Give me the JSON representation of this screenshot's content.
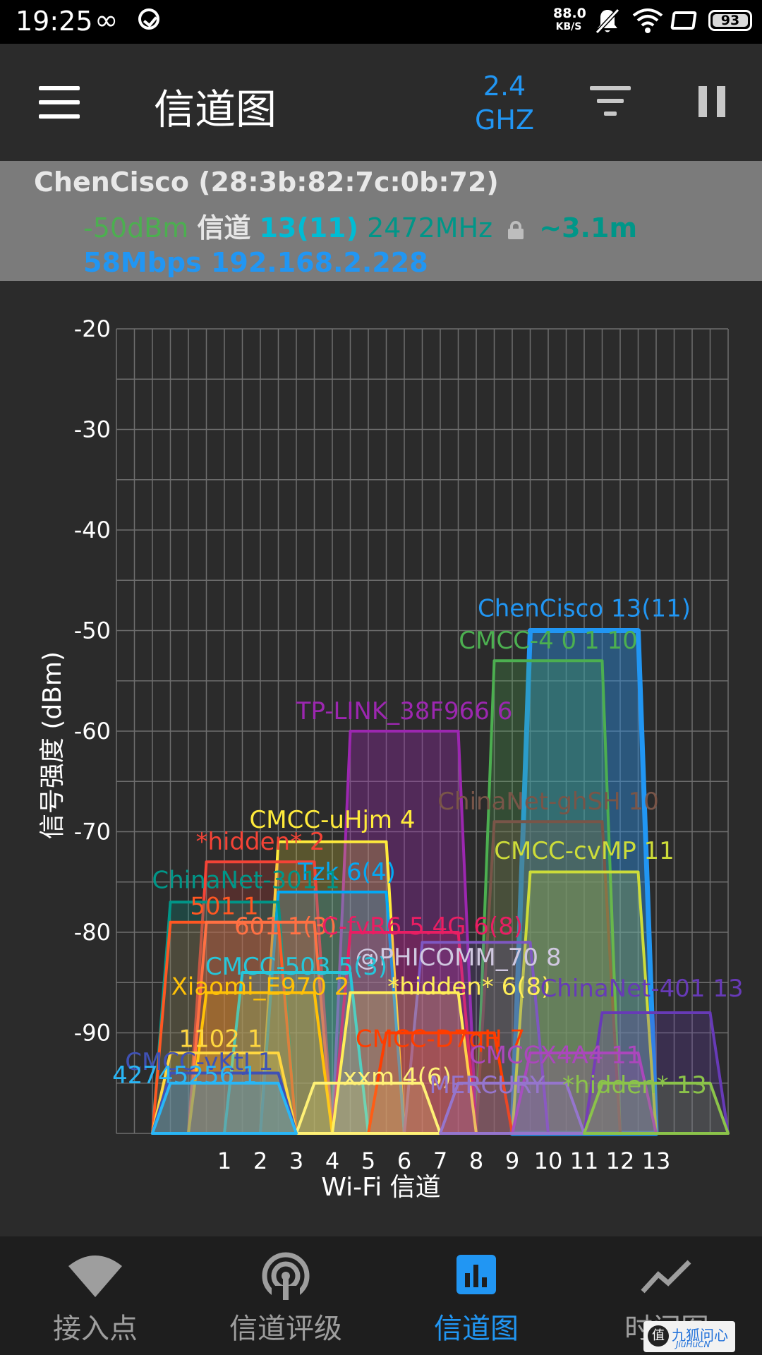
{
  "status_bar": {
    "time": "19:25",
    "infinity": "∞",
    "speed_value": "88.0",
    "speed_unit": "KB/S",
    "battery": "93"
  },
  "toolbar": {
    "title": "信道图",
    "band_top": "2.4",
    "band_bottom": "GHZ"
  },
  "connection": {
    "ssid_mac": "ChenCisco (28:3b:82:7c:0b:72)",
    "signal": "-50dBm",
    "channel_label": "信道",
    "channel": "13(11)",
    "frequency": "2472MHz",
    "distance": "~3.1m",
    "link_ip": "58Mbps 192.168.2.228"
  },
  "chart_data": {
    "type": "area",
    "xlabel": "Wi-Fi 信道",
    "ylabel": "信号强度 (dBm)",
    "xlim": [
      -2,
      15
    ],
    "ylim": [
      -100,
      -20
    ],
    "x_ticks": [
      1,
      2,
      3,
      4,
      5,
      6,
      7,
      8,
      9,
      10,
      11,
      12,
      13
    ],
    "y_ticks": [
      -20,
      -30,
      -40,
      -50,
      -60,
      -70,
      -80,
      -90
    ],
    "series": [
      {
        "name": "ChenCisco 13(11)",
        "center": 11,
        "level": -50,
        "color": "#2196f3",
        "fill": "#2c8fe0",
        "fill_opacity": 0.45,
        "stroke_width": 7
      },
      {
        "name": "CMCC-4 0 1 10",
        "center": 10,
        "level": -53,
        "color": "#4caf50",
        "fill": "#4caf50",
        "fill_opacity": 0.25,
        "stroke_width": 4
      },
      {
        "name": "TP-LINK_38F966 6",
        "center": 6,
        "level": -60,
        "color": "#9c27b0",
        "fill": "#9c27b0",
        "fill_opacity": 0.35,
        "stroke_width": 4
      },
      {
        "name": "ChinaNet-ghSH 10",
        "center": 10,
        "level": -69,
        "color": "#795548",
        "fill": "#795548",
        "fill_opacity": 0.3,
        "stroke_width": 4
      },
      {
        "name": "CMCC-uHjm 4",
        "center": 4,
        "level": -71,
        "color": "#ffeb3b",
        "fill": "#ffeb3b",
        "fill_opacity": 0.22,
        "stroke_width": 4
      },
      {
        "name": "CMCC-cvMP 11",
        "center": 11,
        "level": -74,
        "color": "#cddc39",
        "fill": "#cddc39",
        "fill_opacity": 0.22,
        "stroke_width": 4
      },
      {
        "name": "*hidden* 2",
        "center": 2,
        "level": -73,
        "color": "#f44336",
        "fill": "#f44336",
        "fill_opacity": 0.2,
        "stroke_width": 4
      },
      {
        "name": "Tzk 6(4)",
        "center": 4,
        "level": -76,
        "color": "#03a9f4",
        "fill": "#03a9f4",
        "fill_opacity": 0.2,
        "stroke_width": 4
      },
      {
        "name": "ChinaNet-301 1",
        "center": 1,
        "level": -77,
        "color": "#009688",
        "fill": "#009688",
        "fill_opacity": 0.25,
        "stroke_width": 4
      },
      {
        "name": "501 1",
        "center": 1,
        "level": -79,
        "color": "#ff5722",
        "fill": "#ff5722",
        "fill_opacity": 0.2,
        "stroke_width": 4
      },
      {
        "name": "601 1(3)",
        "center": 2,
        "level": -79,
        "color": "#ff7043",
        "fill": "#ff7043",
        "fill_opacity": 0.18,
        "stroke_width": 4
      },
      {
        "name": "C-fvR6 5.4G 6(8)",
        "center": 6,
        "level": -80,
        "color": "#e91e63",
        "fill": "#e91e63",
        "fill_opacity": 0.18,
        "stroke_width": 4
      },
      {
        "name": "@PHICOMM_70 8",
        "center": 8,
        "level": -81,
        "color": "#7e57c2",
        "fill": "#7e57c2",
        "fill_opacity": 0.2,
        "stroke_width": 4
      },
      {
        "name": "CMCC-503 5(3)",
        "center": 3,
        "level": -84,
        "color": "#26c6da",
        "fill": "#26c6da",
        "fill_opacity": 0.2,
        "stroke_width": 4
      },
      {
        "name": "Xiaomi_E970 2",
        "center": 2,
        "level": -86,
        "color": "#ffc107",
        "fill": "#ffc107",
        "fill_opacity": 0.2,
        "stroke_width": 4
      },
      {
        "name": "*hidden* 6(8)",
        "center": 6,
        "level": -86,
        "color": "#ffee58",
        "fill": "#ffee58",
        "fill_opacity": 0.2,
        "stroke_width": 4
      },
      {
        "name": "ChinaNet-401 13",
        "center": 13,
        "level": -88,
        "color": "#673ab7",
        "fill": "#673ab7",
        "fill_opacity": 0.25,
        "stroke_width": 4
      },
      {
        "name": "CMCC-D7qH 7",
        "center": 7,
        "level": -90,
        "color": "#ff3d00",
        "fill": "#ff3d00",
        "fill_opacity": 0.18,
        "stroke_width": 4
      },
      {
        "name": "1102 1",
        "center": 1,
        "level": -92,
        "color": "#ffd740",
        "fill": "#ffd740",
        "fill_opacity": 0.2,
        "stroke_width": 4
      },
      {
        "name": "CMCC-vKtJ 1",
        "center": 1,
        "level": -94,
        "color": "#3f51b5",
        "fill": "#3f51b5",
        "fill_opacity": 0.25,
        "stroke_width": 4
      },
      {
        "name": "CMCCX4A4 11",
        "center": 11,
        "level": -92,
        "color": "#ab47bc",
        "fill": "#ab47bc",
        "fill_opacity": 0.22,
        "stroke_width": 4
      },
      {
        "name": "xxm 4(6)",
        "center": 5,
        "level": -95,
        "color": "#fff176",
        "fill": "#fff176",
        "fill_opacity": 0.18,
        "stroke_width": 4
      },
      {
        "name": "MERCURY",
        "center": 9,
        "level": -95,
        "color": "#9575cd",
        "fill": "#9575cd",
        "fill_opacity": 0.18,
        "stroke_width": 4
      },
      {
        "name": "*hidden* 13",
        "center": 13,
        "level": -95,
        "color": "#8bc34a",
        "fill": "#8bc34a",
        "fill_opacity": 0.18,
        "stroke_width": 4
      },
      {
        "name": "42745256 1",
        "center": 1,
        "level": -95,
        "color": "#29b6f6",
        "fill": "#29b6f6",
        "fill_opacity": 0.2,
        "stroke_width": 4
      }
    ],
    "labels": [
      {
        "text": "ChenCisco 13(11)",
        "x": 11,
        "y": -48.6,
        "color": "#2196f3"
      },
      {
        "text": "CMCC-4 0 1 10",
        "x": 10,
        "y": -51.8,
        "color": "#4caf50"
      },
      {
        "text": "TP-LINK_38F966 6",
        "x": 6,
        "y": -58.8,
        "color": "#9c27b0"
      },
      {
        "text": "ChinaNet-ghSH 10",
        "x": 10,
        "y": -67.8,
        "color": "#795548"
      },
      {
        "text": "CMCC-uHjm 4",
        "x": 4,
        "y": -69.6,
        "color": "#ffeb3b"
      },
      {
        "text": "*hidden* 2",
        "x": 2,
        "y": -71.8,
        "color": "#f44336"
      },
      {
        "text": "CMCC-cvMP 11",
        "x": 11,
        "y": -72.7,
        "color": "#cddc39"
      },
      {
        "text": "Tzk 6(4)",
        "x": 4.4,
        "y": -74.8,
        "color": "#03a9f4"
      },
      {
        "text": "ChinaNet-301 1",
        "x": 1.6,
        "y": -75.6,
        "color": "#009688"
      },
      {
        "text": "501 1",
        "x": 1,
        "y": -78.2,
        "color": "#ff5722"
      },
      {
        "text": "601 1(3)",
        "x": 2.7,
        "y": -80.2,
        "color": "#ff7043"
      },
      {
        "text": "C-fvR6 5.4G 6(8)",
        "x": 6.5,
        "y": -80.2,
        "color": "#e91e63"
      },
      {
        "text": "@PHICOMM_70 8",
        "x": 7.5,
        "y": -83.3,
        "color": "#d0c8e0"
      },
      {
        "text": "CMCC-503 5(3)",
        "x": 3,
        "y": -84.2,
        "color": "#26c6da"
      },
      {
        "text": "Xiaomi_E970 2",
        "x": 2,
        "y": -86.2,
        "color": "#ffc107"
      },
      {
        "text": "*hidden* 6(8)",
        "x": 7.8,
        "y": -86.2,
        "color": "#ffee58"
      },
      {
        "text": "ChinaNet-401 13",
        "x": 12.6,
        "y": -86.4,
        "color": "#673ab7"
      },
      {
        "text": "CMCC-D7qH 7",
        "x": 7,
        "y": -91.4,
        "color": "#ff3d00"
      },
      {
        "text": "1102 1",
        "x": 0.9,
        "y": -91.4,
        "color": "#ffd740"
      },
      {
        "text": "CMCC-vKtJ 1",
        "x": 0.3,
        "y": -93.7,
        "color": "#3f51b5"
      },
      {
        "text": "CMCCX4A4 11",
        "x": 10.2,
        "y": -93,
        "color": "#ab47bc"
      },
      {
        "text": "xxm 4(6)",
        "x": 5.8,
        "y": -95.2,
        "color": "#fff176"
      },
      {
        "text": "MERCURY",
        "x": 8.3,
        "y": -96,
        "color": "#9575cd"
      },
      {
        "text": "*hidden* 13",
        "x": 12.4,
        "y": -96,
        "color": "#8bc34a"
      },
      {
        "text": "42745256 1",
        "x": -0.1,
        "y": -95,
        "color": "#29b6f6"
      }
    ]
  },
  "bottom_nav": {
    "items": [
      {
        "label": "接入点",
        "icon": "wifi-icon"
      },
      {
        "label": "信道评级",
        "icon": "signal-rating-icon"
      },
      {
        "label": "信道图",
        "icon": "bar-chart-icon"
      },
      {
        "label": "时间图",
        "icon": "line-chart-icon"
      }
    ],
    "active_index": 2,
    "active_color": "#2196f3"
  },
  "watermark": {
    "circle": "值",
    "text": "九狐问心",
    "sub": "JiuHuCN"
  }
}
